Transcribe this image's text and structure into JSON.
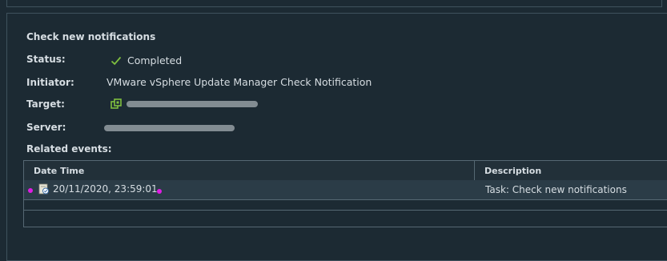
{
  "task": {
    "title": "Check new notifications",
    "fields": {
      "status": {
        "label": "Status:",
        "value": "Completed"
      },
      "initiator": {
        "label": "Initiator:",
        "value": "VMware vSphere Update Manager Check Notification"
      },
      "target": {
        "label": "Target:",
        "value": ""
      },
      "server": {
        "label": "Server:",
        "value": ""
      }
    },
    "related_events_label": "Related events:"
  },
  "events_table": {
    "columns": [
      "Date Time",
      "Description"
    ],
    "rows": [
      {
        "datetime": "20/11/2020, 23:59:01",
        "description": "Task: Check new notifications"
      }
    ]
  },
  "colors": {
    "background": "#1c2a33",
    "success_check": "#7fbf3f",
    "selection_marker": "#e01ce4",
    "link": "#4fa7e0"
  },
  "icons": {
    "status": "check-icon",
    "target": "vm-host-icon",
    "event": "event-task-icon"
  }
}
